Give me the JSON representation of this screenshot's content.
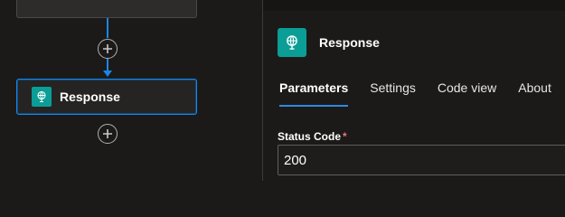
{
  "canvas": {
    "node": {
      "label": "Response",
      "icon": "response-globe-icon"
    },
    "add_step_icon": "plus-circle-icon"
  },
  "panel": {
    "title": "Response",
    "icon": "response-globe-icon",
    "tabs": [
      {
        "label": "Parameters",
        "active": true
      },
      {
        "label": "Settings",
        "active": false
      },
      {
        "label": "Code view",
        "active": false
      },
      {
        "label": "About",
        "active": false
      }
    ],
    "status_code": {
      "label": "Status Code",
      "required_mark": "*",
      "value": "200"
    }
  },
  "colors": {
    "accent": "#1a86e8",
    "icon_bg": "#0a9e96",
    "background": "#1b1a19",
    "required": "#f1707b"
  }
}
